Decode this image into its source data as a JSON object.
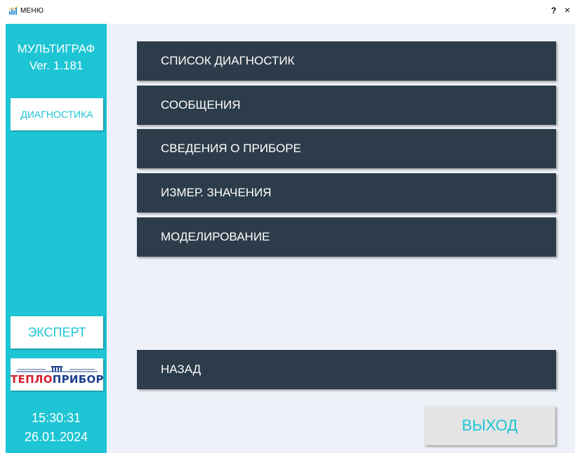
{
  "window": {
    "title": "МЕНЮ",
    "help_label": "?",
    "close_label": "×"
  },
  "sidebar": {
    "app_name": "МУЛЬТИГРАФ",
    "version": "Ver. 1.181",
    "diagnostics_button": "ДИАГНОСТИКА",
    "expert_button": "ЭКСПЕРТ",
    "logo": {
      "top_left_text": "группа предприятий",
      "top_right_text": "челябинск",
      "word_red": "ТЕПЛО",
      "word_blue": "ПРИБОР"
    },
    "time": "15:30:31",
    "date": "26.01.2024"
  },
  "menu": {
    "items": [
      {
        "label": "СПИСОК ДИАГНОСТИК"
      },
      {
        "label": "СООБЩЕНИЯ"
      },
      {
        "label": "СВЕДЕНИЯ О ПРИБОРЕ"
      },
      {
        "label": "ИЗМЕР. ЗНАЧЕНИЯ"
      },
      {
        "label": "МОДЕЛИРОВАНИЕ"
      }
    ],
    "back_label": "НАЗАД",
    "exit_label": "ВЫХОД"
  },
  "colors": {
    "accent": "#1ec5d4",
    "menu_button_bg": "#2d3c4a",
    "main_bg": "#eef2f8",
    "exit_bg": "#e4e4e4",
    "logo_red": "#d9202f",
    "logo_blue": "#1d3f8d"
  }
}
